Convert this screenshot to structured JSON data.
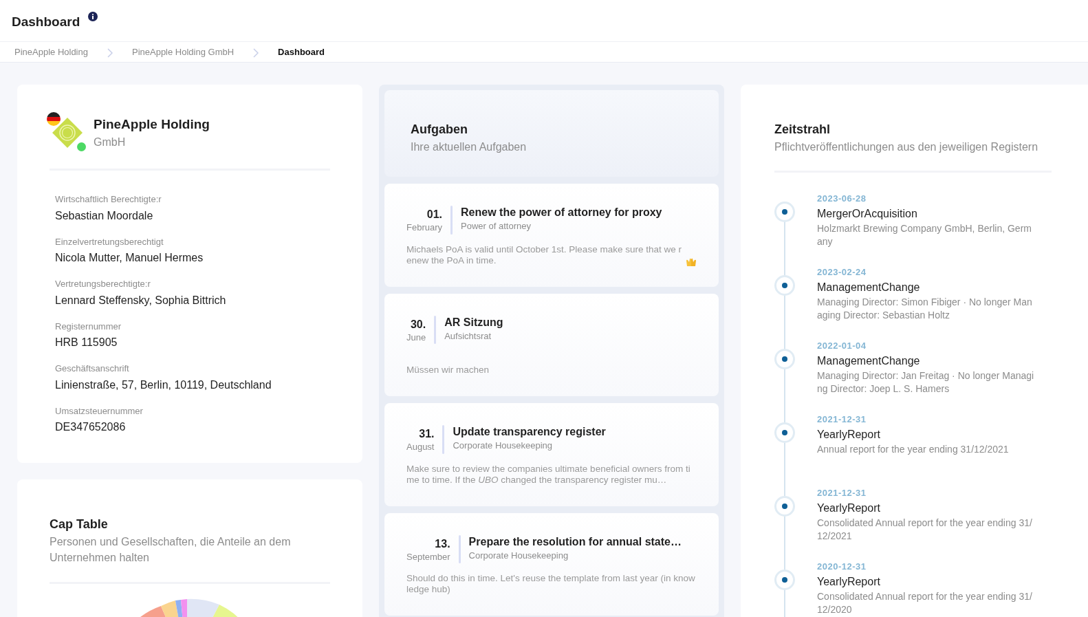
{
  "header": {
    "title": "Dashboard"
  },
  "breadcrumb": [
    {
      "label": "PineApple Holding",
      "current": false
    },
    {
      "label": "PineApple Holding GmbH",
      "current": false
    },
    {
      "label": "Dashboard",
      "current": true
    }
  ],
  "company": {
    "name": "PineApple Holding",
    "legal_form": "GmbH",
    "active": true,
    "fields": [
      {
        "label": "Wirtschaftlich Berechtigte:r",
        "value": "Sebastian Moordale"
      },
      {
        "label": "Einzelvertretungsberechtigt",
        "value": "Nicola Mutter, Manuel Hermes"
      },
      {
        "label": "Vertretungsberechtigte:r",
        "value": "Lennard Steffensky, Sophia Bittrich"
      },
      {
        "label": "Registernummer",
        "value": "HRB 115905"
      },
      {
        "label": "Geschäftsanschrift",
        "value": "Linienstraße, 57, Berlin, 10119, Deutschland"
      },
      {
        "label": "Umsatzsteuernummer",
        "value": "DE347652086"
      }
    ]
  },
  "cap_table": {
    "title": "Cap Table",
    "subtitle": "Personen und Gesellschaften, die Anteile an dem Unternehmen halten"
  },
  "tasks": {
    "title": "Aufgaben",
    "subtitle": "Ihre aktuellen Aufgaben",
    "items": [
      {
        "day": "01.",
        "month": "February",
        "title": "Renew the power of attorney for proxy",
        "category": "Power of attorney",
        "description": "Michaels PoA is valid until October 1st. Please make sure that we renew the PoA in time.",
        "emoji": true
      },
      {
        "day": "30.",
        "month": "June",
        "title": "AR Sitzung",
        "category": "Aufsichtsrat",
        "description": "Müssen wir machen",
        "emoji": false
      },
      {
        "day": "31.",
        "month": "August",
        "title": "Update transparency register",
        "category": "Corporate Housekeeping",
        "description": "Make sure to review the companies ultimate beneficial owners from time to time. If the *UBO* changed the transparency register mu…",
        "emoji": false
      },
      {
        "day": "13.",
        "month": "September",
        "title": "Prepare the resolution for annual state…",
        "category": "Corporate Housekeeping",
        "description": "Should do this in time. Let's reuse the template from last year (in knowledge hub)",
        "emoji": false
      }
    ]
  },
  "timeline": {
    "title": "Zeitstrahl",
    "subtitle": "Pflichtveröffentlichungen aus den jeweiligen Registern",
    "events": [
      {
        "date": "2023-06-28",
        "type": "MergerOrAcquisition",
        "description": "Holzmarkt Brewing Company GmbH, Berlin, Germany"
      },
      {
        "date": "2023-02-24",
        "type": "ManagementChange",
        "description": "Managing Director: Simon Fibiger · No longer Managing Director: Sebastian Holtz"
      },
      {
        "date": "2022-01-04",
        "type": "ManagementChange",
        "description": "Managing Director: Jan Freitag · No longer Managing Director: Joep L. S. Hamers"
      },
      {
        "date": "2021-12-31",
        "type": "YearlyReport",
        "description": "Annual report for the year ending 31/12/2021"
      },
      {
        "date": "2021-12-31",
        "type": "YearlyReport",
        "description": "Consolidated Annual report for the year ending 31/12/2021"
      },
      {
        "date": "2020-12-31",
        "type": "YearlyReport",
        "description": "Consolidated Annual report for the year ending 31/12/2020"
      }
    ]
  }
}
